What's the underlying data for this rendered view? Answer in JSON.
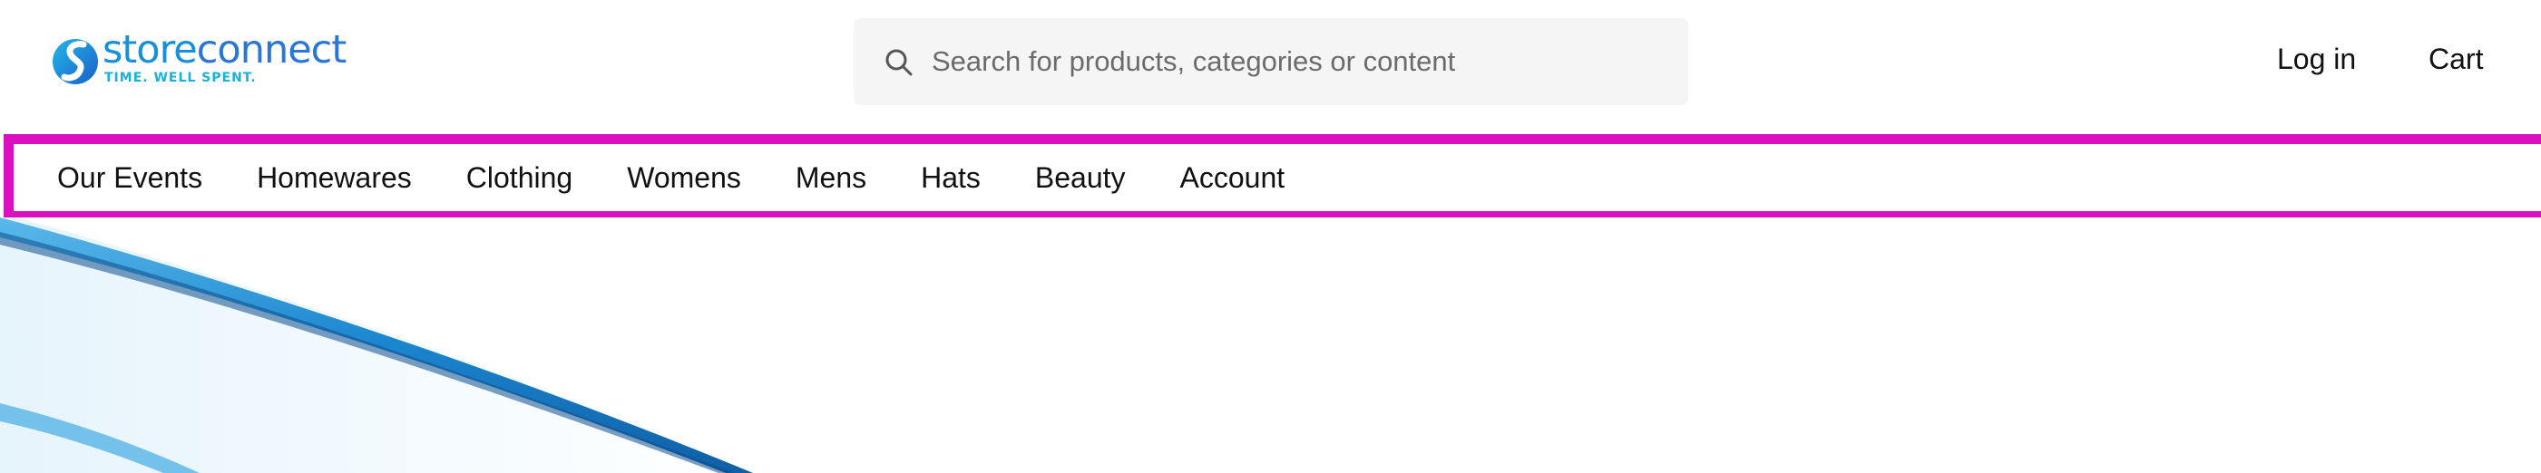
{
  "brand": {
    "name_part1": "store",
    "name_part2": "connect",
    "tagline": "TIME. WELL SPENT.",
    "colors": {
      "primary": "#1790d7",
      "secondary": "#2a76d4",
      "accent": "#19b1d9"
    }
  },
  "search": {
    "placeholder": "Search for products, categories or content",
    "value": "",
    "icon": "search-icon"
  },
  "header_links": {
    "login": "Log in",
    "cart": "Cart"
  },
  "nav": {
    "highlight_color": "#d90fc0",
    "items": [
      {
        "label": "Our Events"
      },
      {
        "label": "Homewares"
      },
      {
        "label": "Clothing"
      },
      {
        "label": "Womens"
      },
      {
        "label": "Mens"
      },
      {
        "label": "Hats"
      },
      {
        "label": "Beauty"
      },
      {
        "label": "Account"
      }
    ]
  },
  "hero": {
    "image": "abstract-blue-waves"
  }
}
